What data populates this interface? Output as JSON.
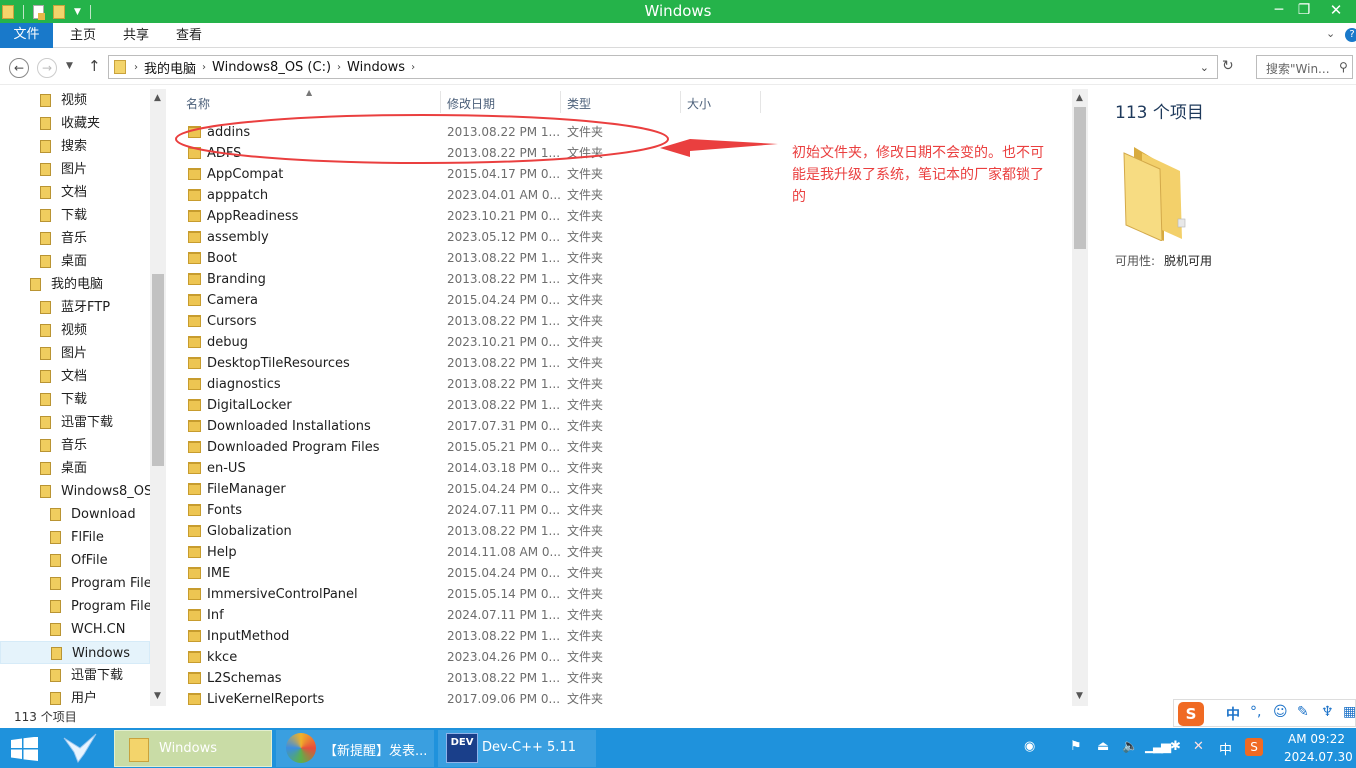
{
  "window": {
    "title": "Windows"
  },
  "ribbon": {
    "tabs": [
      "文件",
      "主页",
      "共享",
      "查看"
    ]
  },
  "address": {
    "crumbs": [
      "我的电脑",
      "Windows8_OS (C:)",
      "Windows"
    ],
    "search_placeholder": "搜索\"Win..."
  },
  "nav": {
    "items": [
      {
        "label": "视频",
        "indent": 1
      },
      {
        "label": "收藏夹",
        "indent": 1
      },
      {
        "label": "搜索",
        "indent": 1
      },
      {
        "label": "图片",
        "indent": 1
      },
      {
        "label": "文档",
        "indent": 1
      },
      {
        "label": "下载",
        "indent": 1
      },
      {
        "label": "音乐",
        "indent": 1
      },
      {
        "label": "桌面",
        "indent": 1
      },
      {
        "label": "我的电脑",
        "indent": 0
      },
      {
        "label": "蓝牙FTP",
        "indent": 1
      },
      {
        "label": "视频",
        "indent": 1
      },
      {
        "label": "图片",
        "indent": 1
      },
      {
        "label": "文档",
        "indent": 1
      },
      {
        "label": "下载",
        "indent": 1
      },
      {
        "label": "迅雷下载",
        "indent": 1
      },
      {
        "label": "音乐",
        "indent": 1
      },
      {
        "label": "桌面",
        "indent": 1
      },
      {
        "label": "Windows8_OS (",
        "indent": 1
      },
      {
        "label": "Download",
        "indent": 2
      },
      {
        "label": "FlFile",
        "indent": 2
      },
      {
        "label": "OfFile",
        "indent": 2
      },
      {
        "label": "Program Files",
        "indent": 2
      },
      {
        "label": "Program Files",
        "indent": 2
      },
      {
        "label": "WCH.CN",
        "indent": 2
      },
      {
        "label": "Windows",
        "indent": 2,
        "selected": true
      },
      {
        "label": "迅雷下载",
        "indent": 2
      },
      {
        "label": "用户",
        "indent": 2
      }
    ]
  },
  "columns": {
    "name": "名称",
    "date": "修改日期",
    "type": "类型",
    "size": "大小"
  },
  "files": [
    {
      "name": "addins",
      "date": "2013.08.22 PM 1...",
      "type": "文件夹"
    },
    {
      "name": "ADFS",
      "date": "2013.08.22 PM 1...",
      "type": "文件夹"
    },
    {
      "name": "AppCompat",
      "date": "2015.04.17 PM 0...",
      "type": "文件夹"
    },
    {
      "name": "apppatch",
      "date": "2023.04.01 AM 0...",
      "type": "文件夹"
    },
    {
      "name": "AppReadiness",
      "date": "2023.10.21 PM 0...",
      "type": "文件夹"
    },
    {
      "name": "assembly",
      "date": "2023.05.12 PM 0...",
      "type": "文件夹"
    },
    {
      "name": "Boot",
      "date": "2013.08.22 PM 1...",
      "type": "文件夹"
    },
    {
      "name": "Branding",
      "date": "2013.08.22 PM 1...",
      "type": "文件夹"
    },
    {
      "name": "Camera",
      "date": "2015.04.24 PM 0...",
      "type": "文件夹"
    },
    {
      "name": "Cursors",
      "date": "2013.08.22 PM 1...",
      "type": "文件夹"
    },
    {
      "name": "debug",
      "date": "2023.10.21 PM 0...",
      "type": "文件夹"
    },
    {
      "name": "DesktopTileResources",
      "date": "2013.08.22 PM 1...",
      "type": "文件夹"
    },
    {
      "name": "diagnostics",
      "date": "2013.08.22 PM 1...",
      "type": "文件夹"
    },
    {
      "name": "DigitalLocker",
      "date": "2013.08.22 PM 1...",
      "type": "文件夹"
    },
    {
      "name": "Downloaded Installations",
      "date": "2017.07.31 PM 0...",
      "type": "文件夹"
    },
    {
      "name": "Downloaded Program Files",
      "date": "2015.05.21 PM 0...",
      "type": "文件夹"
    },
    {
      "name": "en-US",
      "date": "2014.03.18 PM 0...",
      "type": "文件夹"
    },
    {
      "name": "FileManager",
      "date": "2015.04.24 PM 0...",
      "type": "文件夹"
    },
    {
      "name": "Fonts",
      "date": "2024.07.11 PM 0...",
      "type": "文件夹"
    },
    {
      "name": "Globalization",
      "date": "2013.08.22 PM 1...",
      "type": "文件夹"
    },
    {
      "name": "Help",
      "date": "2014.11.08 AM 0...",
      "type": "文件夹"
    },
    {
      "name": "IME",
      "date": "2015.04.24 PM 0...",
      "type": "文件夹"
    },
    {
      "name": "ImmersiveControlPanel",
      "date": "2015.05.14 PM 0...",
      "type": "文件夹"
    },
    {
      "name": "Inf",
      "date": "2024.07.11 PM 1...",
      "type": "文件夹"
    },
    {
      "name": "InputMethod",
      "date": "2013.08.22 PM 1...",
      "type": "文件夹"
    },
    {
      "name": "kkce",
      "date": "2023.04.26 PM 0...",
      "type": "文件夹"
    },
    {
      "name": "L2Schemas",
      "date": "2013.08.22 PM 1...",
      "type": "文件夹"
    },
    {
      "name": "LiveKernelReports",
      "date": "2017.09.06 PM 0...",
      "type": "文件夹"
    }
  ],
  "details": {
    "count": "113 个项目",
    "availability_label": "可用性:",
    "availability_value": "脱机可用"
  },
  "annotation": {
    "text": "初始文件夹，修改日期不会变的。也不可能是我升级了系统，笔记本的厂家都锁了的"
  },
  "status": {
    "count": "113 个项目"
  },
  "taskbar": {
    "items": [
      {
        "label": "Windows",
        "active": true
      },
      {
        "label": "【新提醒】发表..."
      },
      {
        "label": "Dev-C++ 5.11"
      }
    ],
    "dev_icon_text": "DEV",
    "ime_lang": "中",
    "time": "AM 09:22",
    "date": "2024.07.30"
  },
  "ime": {
    "logo": "S",
    "mode": "中"
  },
  "colors": {
    "titlebar": "#25b34a",
    "file_tab": "#1979ca",
    "taskbar": "#1f92dc",
    "annotation": "#ea3f3f"
  }
}
